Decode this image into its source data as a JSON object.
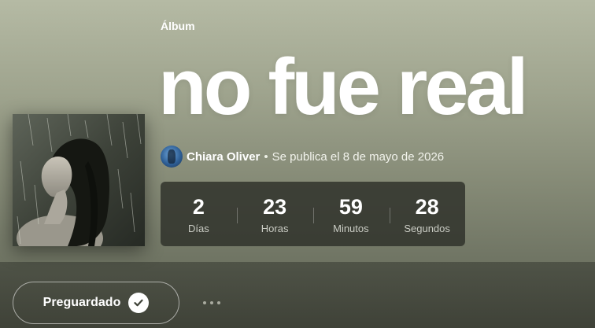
{
  "album": {
    "type_label": "Álbum",
    "title": "no fue real"
  },
  "artist": {
    "name": "Chiara Oliver",
    "separator": "•",
    "release_text": "Se publica el 8 de mayo de 2026"
  },
  "countdown": [
    {
      "value": "2",
      "label": "Días"
    },
    {
      "value": "23",
      "label": "Horas"
    },
    {
      "value": "59",
      "label": "Minutos"
    },
    {
      "value": "28",
      "label": "Segundos"
    }
  ],
  "actions": {
    "presave_label": "Preguardado",
    "presave_icon": "check-circle-icon",
    "more_icon": "more-options-icon"
  },
  "colors": {
    "hero_top": "#b5baa4",
    "hero_bottom": "#6f7463",
    "countdown_bg": "#30322c",
    "text": "#ffffff"
  }
}
